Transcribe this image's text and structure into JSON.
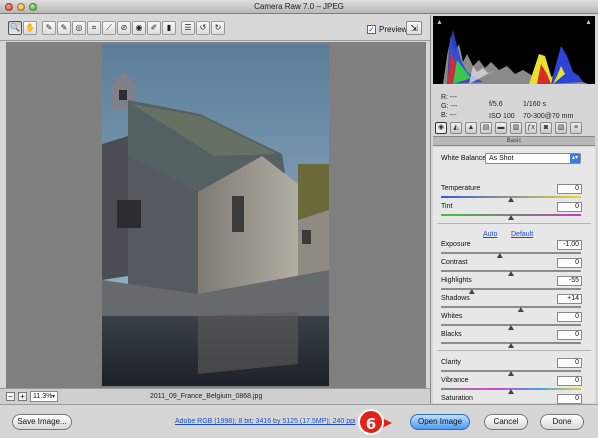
{
  "window": {
    "title": "Camera Raw 7.0  –  JPEG"
  },
  "toolbar": {
    "tools": [
      {
        "name": "zoom-tool",
        "glyph": "🔍"
      },
      {
        "name": "hand-tool",
        "glyph": "✋"
      },
      {
        "name": "white-balance-tool",
        "glyph": "✎"
      },
      {
        "name": "color-sampler-tool",
        "glyph": "✎"
      },
      {
        "name": "targeted-adjustment-tool",
        "glyph": "◎"
      },
      {
        "name": "crop-tool",
        "glyph": "⌗"
      },
      {
        "name": "straighten-tool",
        "glyph": "⟋"
      },
      {
        "name": "spot-removal-tool",
        "glyph": "⊘"
      },
      {
        "name": "red-eye-tool",
        "glyph": "◉"
      },
      {
        "name": "adjustment-brush-tool",
        "glyph": "✐"
      },
      {
        "name": "graduated-filter-tool",
        "glyph": "▮"
      },
      {
        "name": "preferences-tool",
        "glyph": "☰"
      },
      {
        "name": "rotate-ccw-tool",
        "glyph": "↺"
      },
      {
        "name": "rotate-cw-tool",
        "glyph": "↻"
      }
    ],
    "preview_label": "Preview",
    "preview_checked": "✓",
    "fullscreen_glyph": "⇲"
  },
  "bottombar": {
    "zoom_out": "−",
    "zoom_in": "+",
    "zoom_value": "11.3%",
    "zoom_arrow": "▾",
    "filename": "2011_09_France_Belgium_0868.jpg"
  },
  "info": {
    "r_label": "R:",
    "g_label": "G:",
    "b_label": "B:",
    "r_value": "---",
    "g_value": "---",
    "b_value": "---",
    "aperture": "f/5.6",
    "shutter": "1/160 s",
    "iso": "ISO 100",
    "lens": "70-300@70 mm"
  },
  "panel": {
    "section_title": "Basic",
    "tab_glyphs": [
      "◉",
      "◭",
      "▲",
      "▤",
      "▬",
      "▥",
      "ƒx",
      "◙",
      "▧",
      "≡"
    ],
    "white_balance": {
      "label": "White Balance:",
      "value": "As Shot"
    },
    "auto_link": "Auto",
    "default_link": "Default",
    "sliders": [
      {
        "key": "temperature",
        "label": "Temperature",
        "value": "0",
        "pos": 0.5,
        "track": "temp"
      },
      {
        "key": "tint",
        "label": "Tint",
        "value": "0",
        "pos": 0.5,
        "track": "tint"
      },
      {
        "key": "exposure",
        "label": "Exposure",
        "value": "-1.00",
        "pos": 0.42,
        "track": ""
      },
      {
        "key": "contrast",
        "label": "Contrast",
        "value": "0",
        "pos": 0.5,
        "track": ""
      },
      {
        "key": "highlights",
        "label": "Highlights",
        "value": "-55",
        "pos": 0.22,
        "track": ""
      },
      {
        "key": "shadows",
        "label": "Shadows",
        "value": "+14",
        "pos": 0.57,
        "track": ""
      },
      {
        "key": "whites",
        "label": "Whites",
        "value": "0",
        "pos": 0.5,
        "track": ""
      },
      {
        "key": "blacks",
        "label": "Blacks",
        "value": "0",
        "pos": 0.5,
        "track": ""
      },
      {
        "key": "clarity",
        "label": "Clarity",
        "value": "0",
        "pos": 0.5,
        "track": ""
      },
      {
        "key": "vibrance",
        "label": "Vibrance",
        "value": "0",
        "pos": 0.5,
        "track": "vib"
      },
      {
        "key": "saturation",
        "label": "Saturation",
        "value": "0",
        "pos": 0.5,
        "track": "sat"
      }
    ]
  },
  "footer": {
    "save_image": "Save Image...",
    "workflow_link": "Adobe RGB (1998); 8 bit; 3416 by 5125 (17.5MP); 240 ppi",
    "step_number": "6",
    "open_image": "Open Image",
    "cancel": "Cancel",
    "done": "Done"
  },
  "colors": {
    "accent_blue": "#4d9cf0",
    "step_badge_red": "#e2231a",
    "preview_bg": "#7f7f7f"
  }
}
